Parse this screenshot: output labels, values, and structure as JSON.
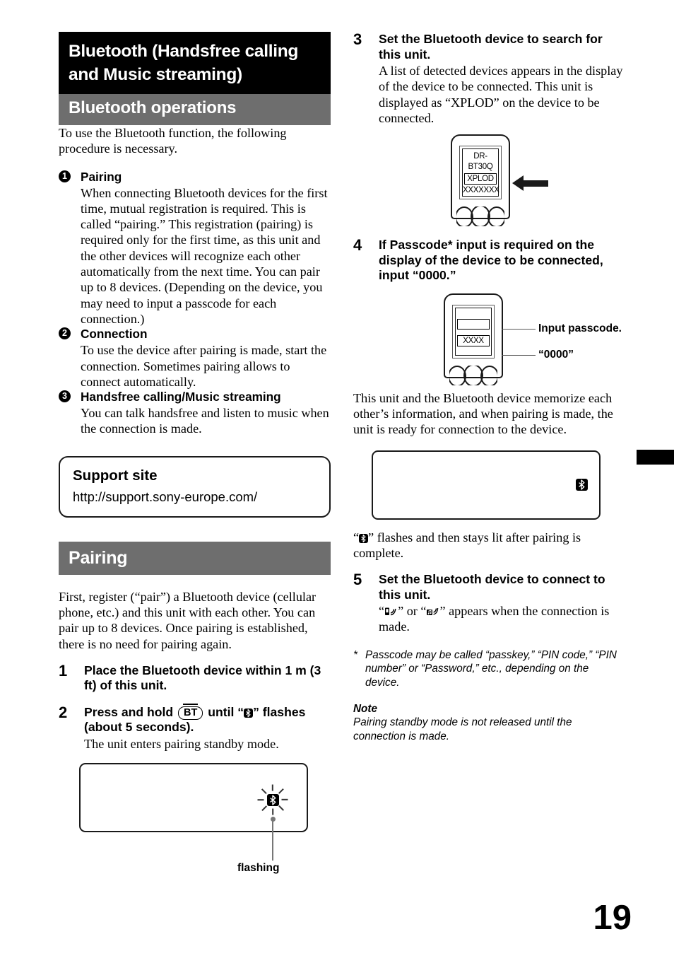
{
  "page": {
    "number": "19",
    "edge_tab_color": "#000000",
    "header_black_bg": "#000000",
    "header_gray_bg": "#6e6e6e"
  },
  "chapter": {
    "title": "Bluetooth (Handsfree calling and Music streaming)",
    "section": "Bluetooth operations"
  },
  "intro": {
    "text": "To use the Bluetooth function, the following procedure is necessary."
  },
  "overview_list": [
    {
      "num": "1",
      "heading": "Pairing",
      "body": "When connecting Bluetooth devices for the first time, mutual registration is required. This is called “pairing.” This registration (pairing) is required only for the first time, as this unit and the other devices will recognize each other automatically from the next time. You can pair up to 8 devices. (Depending on the device, you may need to input a passcode for each connection.)"
    },
    {
      "num": "2",
      "heading": "Connection",
      "body": "To use the device after pairing is made, start the connection. Sometimes pairing allows to connect automatically."
    },
    {
      "num": "3",
      "heading": "Handsfree calling/Music streaming",
      "body": "You can talk handsfree and listen to music when the connection is made."
    }
  ],
  "support": {
    "title": "Support site",
    "url": "http://support.sony-europe.com/"
  },
  "pairing": {
    "heading": "Pairing",
    "intro": "First, register (“pair”) a Bluetooth device (cellular phone, etc.) and this unit with each other. You can pair up to 8 devices. Once pairing is established, there is no need for pairing again."
  },
  "steps": [
    {
      "num": "1",
      "heading": "Place the Bluetooth device within 1 m (3 ft) of this unit.",
      "body": ""
    },
    {
      "num": "2",
      "heading_parts": {
        "before": "Press and hold",
        "key": "BT",
        "middle": "until “",
        "after": "” flashes (about 5 seconds)."
      },
      "body": "The unit enters pairing standby mode."
    },
    {
      "num": "3",
      "heading": "Set the Bluetooth device to search for this unit.",
      "body": "A list of detected devices appears in the display of the device to be connected. This unit is displayed as “XPLOD” on the device to be connected."
    },
    {
      "num": "4",
      "heading": "If Passcode* input is required on the display of the device to be connected, input “0000.”",
      "body": "This unit and the Bluetooth device memorize each other’s information, and when pairing is made, the unit is ready for connection to the device."
    },
    {
      "num": "5",
      "heading": "Set the Bluetooth device to connect to this unit.",
      "body_after": "” appears when the connection is made.",
      "body_mid": "” or “",
      "body_before": "“"
    }
  ],
  "illustrations": {
    "flashing_label": "flashing",
    "device_list": {
      "line1": "DR-BT30Q",
      "line2": "XPLOD",
      "line3": "XXXXXXX"
    },
    "passcode": {
      "field_value": "XXXX",
      "callout1": "Input passcode.",
      "callout2": "“0000”"
    }
  },
  "after_panel": {
    "text_before_icon": "“",
    "text_after_icon": "” flashes and then stays lit after pairing is complete."
  },
  "footnote": {
    "marker": "*",
    "text": "Passcode may be called “passkey,” “PIN code,” “PIN number” or “Password,” etc., depending on the device."
  },
  "note": {
    "heading": "Note",
    "text": "Pairing standby mode is not released until the connection is made."
  }
}
